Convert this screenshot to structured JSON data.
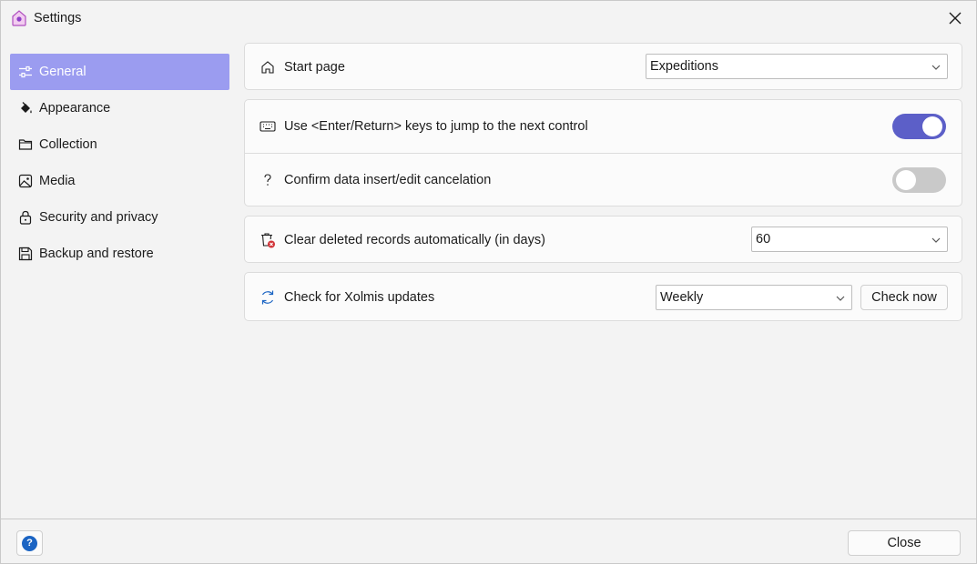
{
  "window": {
    "title": "Settings",
    "app_icon": "home-badge-icon",
    "close_icon": "close-icon"
  },
  "sidebar": {
    "items": [
      {
        "label": "General",
        "icon": "sliders-icon",
        "active": true
      },
      {
        "label": "Appearance",
        "icon": "paint-bucket-icon",
        "active": false
      },
      {
        "label": "Collection",
        "icon": "folder-icon",
        "active": false
      },
      {
        "label": "Media",
        "icon": "image-icon",
        "active": false
      },
      {
        "label": "Security and privacy",
        "icon": "lock-icon",
        "active": false
      },
      {
        "label": "Backup and restore",
        "icon": "save-icon",
        "active": false
      }
    ]
  },
  "general": {
    "start_page": {
      "label": "Start page",
      "icon": "home-icon",
      "value": "Expeditions"
    },
    "enter_key": {
      "label": "Use <Enter/Return> keys to jump to the next control",
      "icon": "keyboard-icon",
      "enabled": true
    },
    "confirm_cancel": {
      "label": "Confirm data insert/edit cancelation",
      "icon": "question-icon",
      "enabled": false
    },
    "clear_deleted": {
      "label": "Clear deleted records automatically (in days)",
      "icon": "trash-error-icon",
      "value": "60"
    },
    "updates": {
      "label": "Check for Xolmis updates",
      "icon": "refresh-icon",
      "value": "Weekly",
      "button": "Check now"
    }
  },
  "footer": {
    "help_glyph": "?",
    "close_label": "Close"
  },
  "colors": {
    "accent": "#5c5fc8",
    "active_nav": "#9b9cf0",
    "help": "#1b64c3",
    "error": "#d13438"
  }
}
